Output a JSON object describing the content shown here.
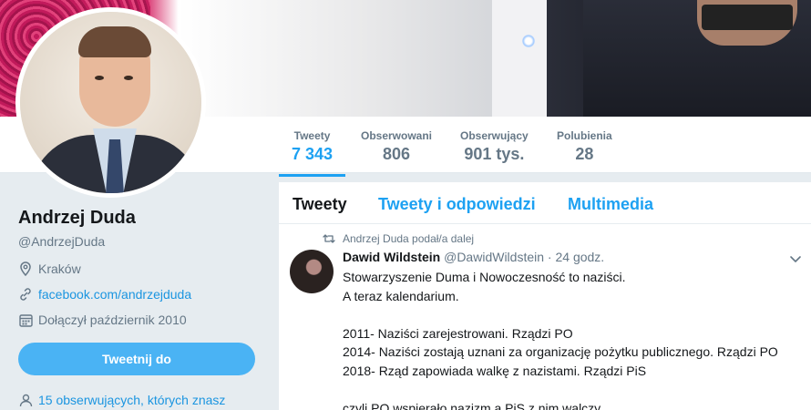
{
  "profile": {
    "name": "Andrzej Duda",
    "handle": "@AndrzejDuda",
    "location": "Kraków",
    "website": "facebook.com/andrzejduda",
    "joined": "Dołączył październik 2010",
    "tweet_to_label": "Tweetnij do",
    "followers_you_know": "15 obserwujących, których znasz"
  },
  "stats": [
    {
      "label": "Tweety",
      "value": "7 343"
    },
    {
      "label": "Obserwowani",
      "value": "806"
    },
    {
      "label": "Obserwujący",
      "value": "901 tys."
    },
    {
      "label": "Polubienia",
      "value": "28"
    }
  ],
  "timeline": {
    "tabs": [
      "Tweety",
      "Tweety i odpowiedzi",
      "Multimedia"
    ],
    "tweet": {
      "retweet_note": "Andrzej Duda podał/a dalej",
      "author_name": "Dawid Wildstein",
      "author_handle": "@DawidWildstein",
      "separator": "·",
      "time": "24 godz.",
      "lines": [
        "Stowarzyszenie Duma i Nowoczesność to naziści.",
        "A teraz kalendarium.",
        "",
        "2011- Naziści zarejestrowani. Rządzi PO",
        "2014- Naziści zostają uznani za organizację pożytku publicznego. Rządzi PO",
        "2018- Rząd zapowiada walkę z nazistami. Rządzi PiS",
        "",
        "czyli PO wspierało nazizm a PiS z nim walczy"
      ]
    }
  },
  "colors": {
    "accent": "#1da1f2",
    "button": "#4ab3f4",
    "muted": "#657786",
    "background": "#e6ecf0"
  },
  "icons": {
    "location": "location-pin-icon",
    "website": "link-icon",
    "joined": "calendar-icon",
    "followers": "person-icon",
    "retweet": "retweet-icon",
    "caret": "chevron-down-icon"
  }
}
